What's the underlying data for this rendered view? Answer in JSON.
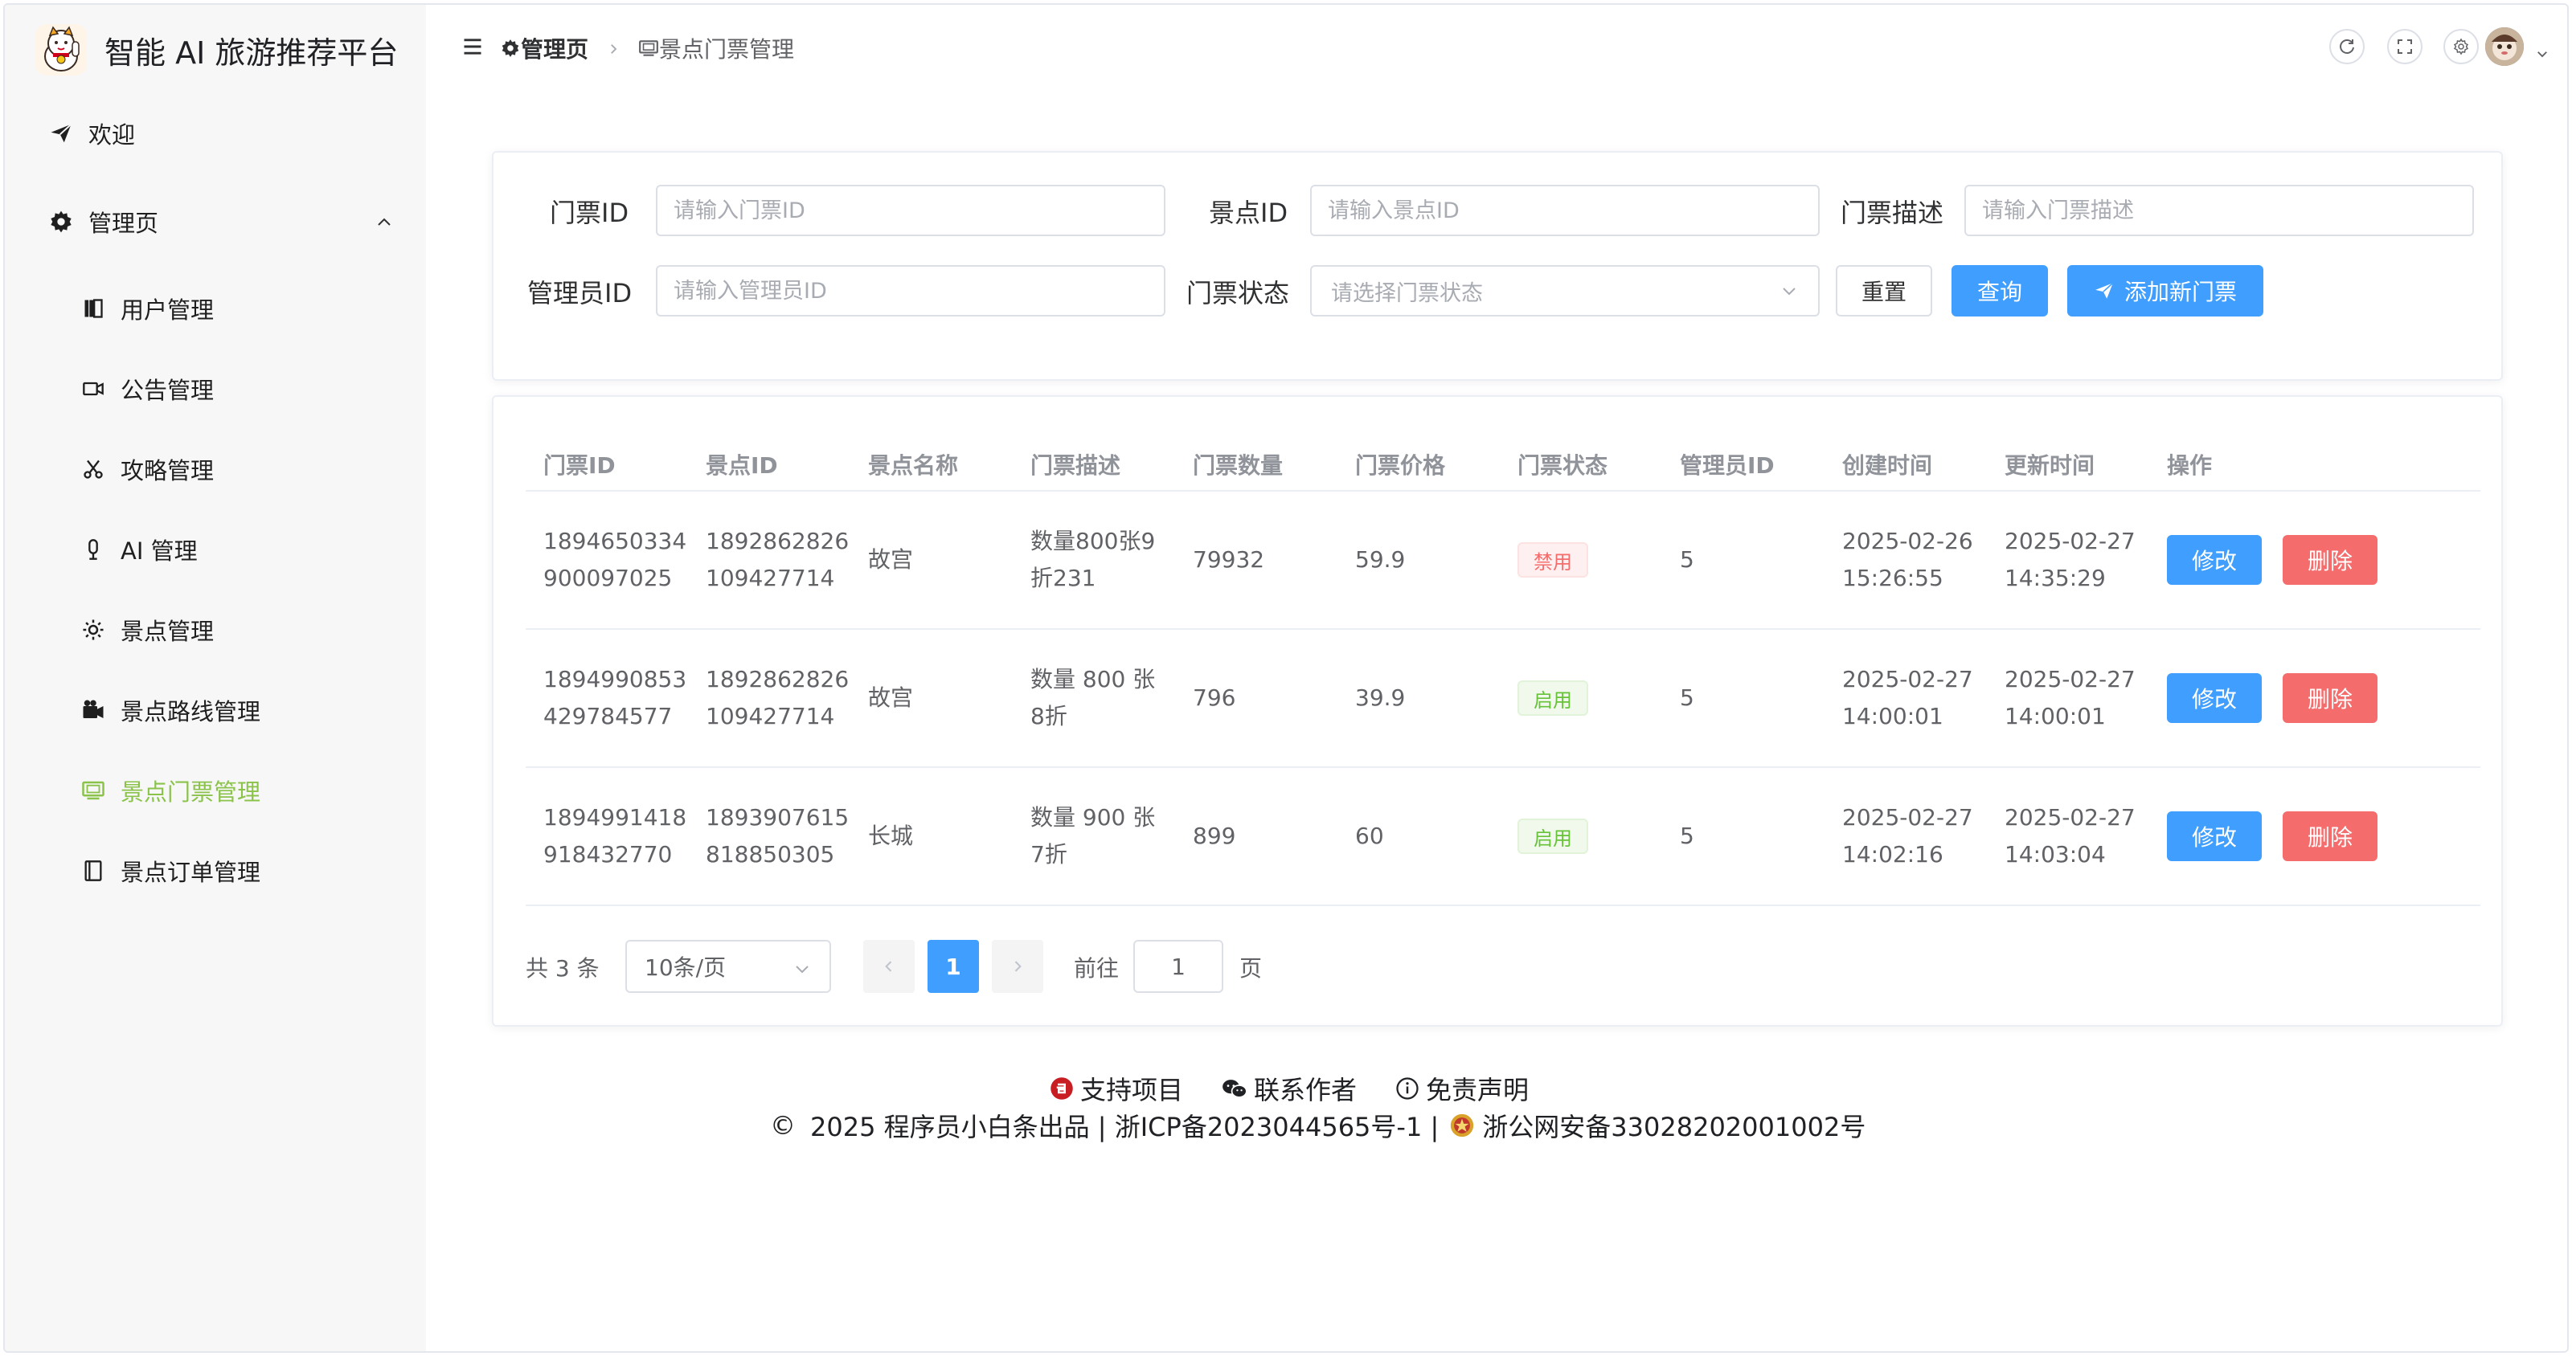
{
  "app": {
    "title": "智能 AI 旅游推荐平台"
  },
  "sidebar": {
    "items": [
      {
        "label": "欢迎",
        "icon": "send-icon"
      },
      {
        "label": "管理页",
        "icon": "gear-icon"
      },
      {
        "label": "用户管理",
        "icon": "book-icon"
      },
      {
        "label": "公告管理",
        "icon": "video-icon"
      },
      {
        "label": "攻略管理",
        "icon": "scissors-icon"
      },
      {
        "label": "AI 管理",
        "icon": "microphone-icon"
      },
      {
        "label": "景点管理",
        "icon": "sun-icon"
      },
      {
        "label": "景点路线管理",
        "icon": "camera-icon"
      },
      {
        "label": "景点门票管理",
        "icon": "ticket-icon",
        "active": true
      },
      {
        "label": "景点订单管理",
        "icon": "notebook-icon"
      }
    ]
  },
  "breadcrumb": {
    "root": "管理页",
    "current": "景点门票管理"
  },
  "search": {
    "ticket_id_label": "门票ID",
    "ticket_id_placeholder": "请输入门票ID",
    "spot_id_label": "景点ID",
    "spot_id_placeholder": "请输入景点ID",
    "desc_label": "门票描述",
    "desc_placeholder": "请输入门票描述",
    "admin_id_label": "管理员ID",
    "admin_id_placeholder": "请输入管理员ID",
    "status_label": "门票状态",
    "status_placeholder": "请选择门票状态",
    "reset_label": "重置",
    "query_label": "查询",
    "add_label": "添加新门票"
  },
  "table": {
    "columns": [
      "门票ID",
      "景点ID",
      "景点名称",
      "门票描述",
      "门票数量",
      "门票价格",
      "门票状态",
      "管理员ID",
      "创建时间",
      "更新时间",
      "操作"
    ],
    "edit_label": "修改",
    "delete_label": "删除",
    "rows": [
      {
        "ticket_id": "1894650334900097025",
        "spot_id": "1892862826109427714",
        "spot_name": "故宫",
        "desc": "数量800张9折231",
        "count": "79932",
        "price": "59.9",
        "status": "禁用",
        "status_type": "danger",
        "admin_id": "5",
        "created": "2025-02-26 15:26:55",
        "updated": "2025-02-27 14:35:29"
      },
      {
        "ticket_id": "1894990853429784577",
        "spot_id": "1892862826109427714",
        "spot_name": "故宫",
        "desc": "数量 800 张 8折",
        "count": "796",
        "price": "39.9",
        "status": "启用",
        "status_type": "success",
        "admin_id": "5",
        "created": "2025-02-27 14:00:01",
        "updated": "2025-02-27 14:00:01"
      },
      {
        "ticket_id": "1894991418918432770",
        "spot_id": "1893907615818850305",
        "spot_name": "长城",
        "desc": "数量 900 张 7折",
        "count": "899",
        "price": "60",
        "status": "启用",
        "status_type": "success",
        "admin_id": "5",
        "created": "2025-02-27 14:02:16",
        "updated": "2025-02-27 14:03:04"
      }
    ]
  },
  "pagination": {
    "total": "共 3 条",
    "page_size": "10条/页",
    "current_page": "1",
    "goto_prefix": "前往",
    "goto_value": "1",
    "goto_suffix": "页"
  },
  "footer": {
    "support": "支持项目",
    "contact": "联系作者",
    "disclaimer": "免责声明",
    "copyright": "2025 程序员小白条出品 | 浙ICP备2023044565号-1 |",
    "police": "浙公网安备33028202001002号"
  },
  "colors": {
    "primary": "#409eff",
    "danger": "#f56c6c",
    "success": "#67c23a",
    "active_menu": "#8bc34a"
  }
}
